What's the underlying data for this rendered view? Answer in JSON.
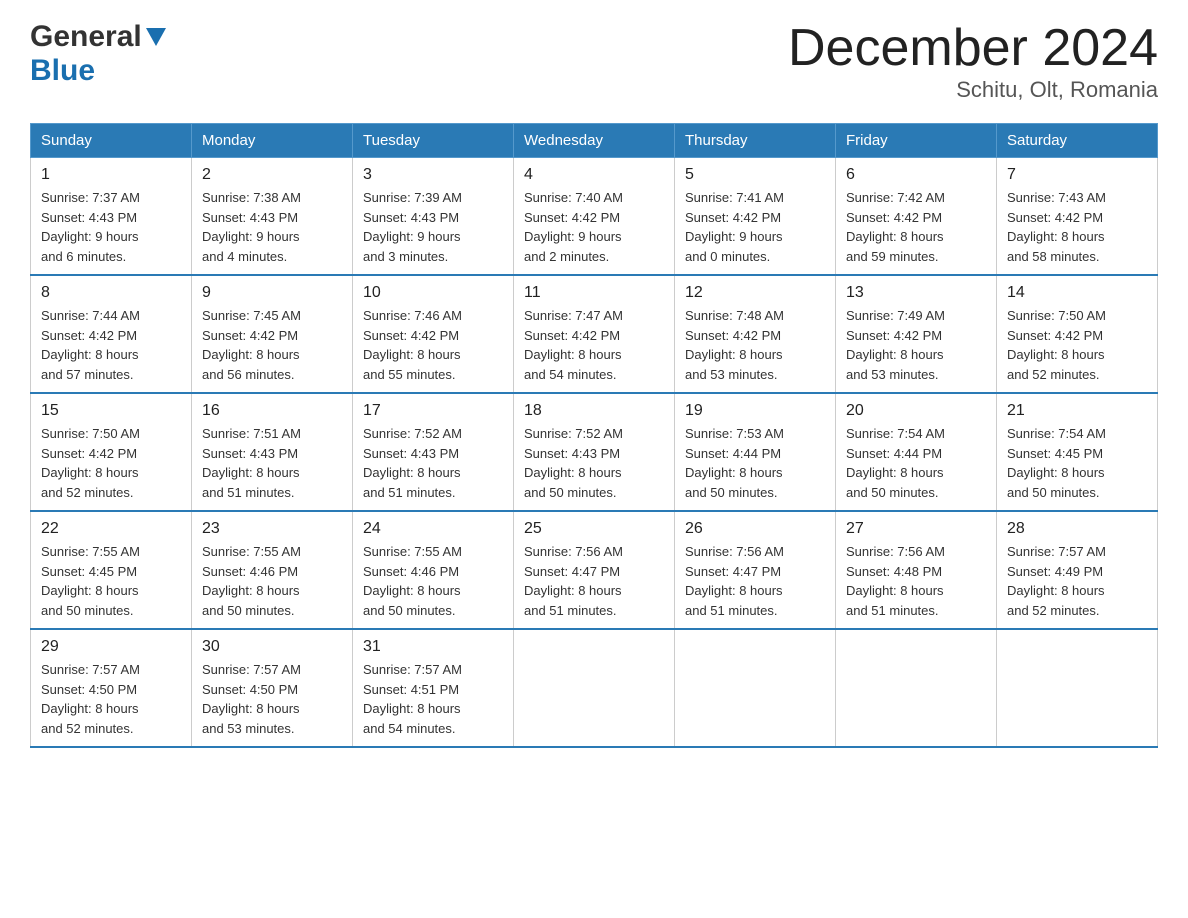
{
  "header": {
    "logo_general": "General",
    "logo_blue": "Blue",
    "month_title": "December 2024",
    "location": "Schitu, Olt, Romania"
  },
  "weekdays": [
    "Sunday",
    "Monday",
    "Tuesday",
    "Wednesday",
    "Thursday",
    "Friday",
    "Saturday"
  ],
  "weeks": [
    [
      {
        "day": "1",
        "sunrise": "7:37 AM",
        "sunset": "4:43 PM",
        "daylight": "9 hours and 6 minutes."
      },
      {
        "day": "2",
        "sunrise": "7:38 AM",
        "sunset": "4:43 PM",
        "daylight": "9 hours and 4 minutes."
      },
      {
        "day": "3",
        "sunrise": "7:39 AM",
        "sunset": "4:43 PM",
        "daylight": "9 hours and 3 minutes."
      },
      {
        "day": "4",
        "sunrise": "7:40 AM",
        "sunset": "4:42 PM",
        "daylight": "9 hours and 2 minutes."
      },
      {
        "day": "5",
        "sunrise": "7:41 AM",
        "sunset": "4:42 PM",
        "daylight": "9 hours and 0 minutes."
      },
      {
        "day": "6",
        "sunrise": "7:42 AM",
        "sunset": "4:42 PM",
        "daylight": "8 hours and 59 minutes."
      },
      {
        "day": "7",
        "sunrise": "7:43 AM",
        "sunset": "4:42 PM",
        "daylight": "8 hours and 58 minutes."
      }
    ],
    [
      {
        "day": "8",
        "sunrise": "7:44 AM",
        "sunset": "4:42 PM",
        "daylight": "8 hours and 57 minutes."
      },
      {
        "day": "9",
        "sunrise": "7:45 AM",
        "sunset": "4:42 PM",
        "daylight": "8 hours and 56 minutes."
      },
      {
        "day": "10",
        "sunrise": "7:46 AM",
        "sunset": "4:42 PM",
        "daylight": "8 hours and 55 minutes."
      },
      {
        "day": "11",
        "sunrise": "7:47 AM",
        "sunset": "4:42 PM",
        "daylight": "8 hours and 54 minutes."
      },
      {
        "day": "12",
        "sunrise": "7:48 AM",
        "sunset": "4:42 PM",
        "daylight": "8 hours and 53 minutes."
      },
      {
        "day": "13",
        "sunrise": "7:49 AM",
        "sunset": "4:42 PM",
        "daylight": "8 hours and 53 minutes."
      },
      {
        "day": "14",
        "sunrise": "7:50 AM",
        "sunset": "4:42 PM",
        "daylight": "8 hours and 52 minutes."
      }
    ],
    [
      {
        "day": "15",
        "sunrise": "7:50 AM",
        "sunset": "4:42 PM",
        "daylight": "8 hours and 52 minutes."
      },
      {
        "day": "16",
        "sunrise": "7:51 AM",
        "sunset": "4:43 PM",
        "daylight": "8 hours and 51 minutes."
      },
      {
        "day": "17",
        "sunrise": "7:52 AM",
        "sunset": "4:43 PM",
        "daylight": "8 hours and 51 minutes."
      },
      {
        "day": "18",
        "sunrise": "7:52 AM",
        "sunset": "4:43 PM",
        "daylight": "8 hours and 50 minutes."
      },
      {
        "day": "19",
        "sunrise": "7:53 AM",
        "sunset": "4:44 PM",
        "daylight": "8 hours and 50 minutes."
      },
      {
        "day": "20",
        "sunrise": "7:54 AM",
        "sunset": "4:44 PM",
        "daylight": "8 hours and 50 minutes."
      },
      {
        "day": "21",
        "sunrise": "7:54 AM",
        "sunset": "4:45 PM",
        "daylight": "8 hours and 50 minutes."
      }
    ],
    [
      {
        "day": "22",
        "sunrise": "7:55 AM",
        "sunset": "4:45 PM",
        "daylight": "8 hours and 50 minutes."
      },
      {
        "day": "23",
        "sunrise": "7:55 AM",
        "sunset": "4:46 PM",
        "daylight": "8 hours and 50 minutes."
      },
      {
        "day": "24",
        "sunrise": "7:55 AM",
        "sunset": "4:46 PM",
        "daylight": "8 hours and 50 minutes."
      },
      {
        "day": "25",
        "sunrise": "7:56 AM",
        "sunset": "4:47 PM",
        "daylight": "8 hours and 51 minutes."
      },
      {
        "day": "26",
        "sunrise": "7:56 AM",
        "sunset": "4:47 PM",
        "daylight": "8 hours and 51 minutes."
      },
      {
        "day": "27",
        "sunrise": "7:56 AM",
        "sunset": "4:48 PM",
        "daylight": "8 hours and 51 minutes."
      },
      {
        "day": "28",
        "sunrise": "7:57 AM",
        "sunset": "4:49 PM",
        "daylight": "8 hours and 52 minutes."
      }
    ],
    [
      {
        "day": "29",
        "sunrise": "7:57 AM",
        "sunset": "4:50 PM",
        "daylight": "8 hours and 52 minutes."
      },
      {
        "day": "30",
        "sunrise": "7:57 AM",
        "sunset": "4:50 PM",
        "daylight": "8 hours and 53 minutes."
      },
      {
        "day": "31",
        "sunrise": "7:57 AM",
        "sunset": "4:51 PM",
        "daylight": "8 hours and 54 minutes."
      },
      null,
      null,
      null,
      null
    ]
  ],
  "labels": {
    "sunrise": "Sunrise:",
    "sunset": "Sunset:",
    "daylight": "Daylight:"
  }
}
